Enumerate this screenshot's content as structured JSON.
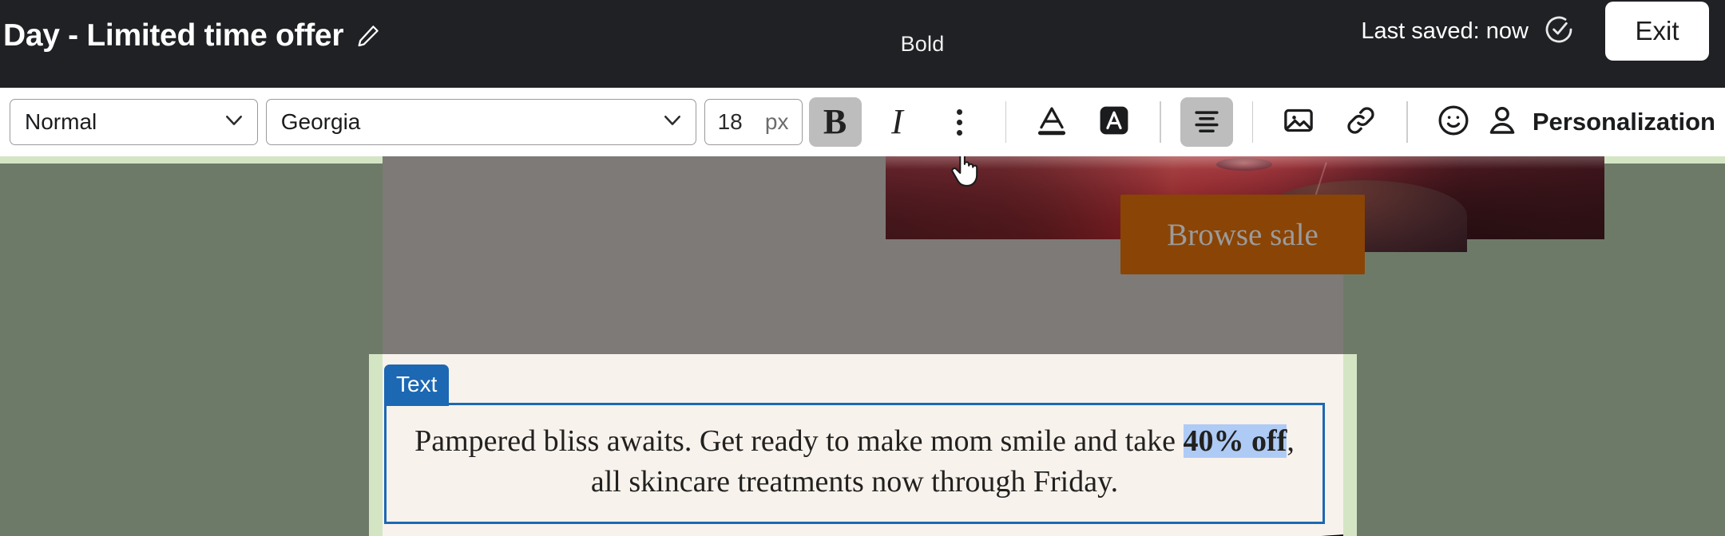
{
  "header": {
    "campaign_title": "Day - Limited time offer",
    "edit_icon": "pencil-icon",
    "tooltip": "Bold",
    "last_saved": "Last saved: now",
    "saved_icon": "check-circle-icon",
    "exit_label": "Exit"
  },
  "toolbar": {
    "paragraph_style": "Normal",
    "font_family": "Georgia",
    "font_size_value": "18",
    "font_size_unit": "px",
    "bold_label": "B",
    "italic_label": "I",
    "more_options_icon": "vertical-dots-icon",
    "text_color_icon": "text-color-icon",
    "highlight_color_icon": "highlight-color-icon",
    "align_icon": "align-center-icon",
    "image_icon": "image-icon",
    "link_icon": "link-icon",
    "emoji_icon": "emoji-icon",
    "personalization_icon": "person-icon",
    "personalization_label": "Personalization"
  },
  "canvas": {
    "browse_button_label": "Browse sale",
    "block_badge": "Text",
    "body_line_1": "Pampered bliss awaits. Get ready to make mom smile and take",
    "body_selected": "40% off",
    "body_line_2_rest": ", all skincare treatments now through Friday."
  },
  "colors": {
    "topbar_bg": "#1f2124",
    "toolbar_bg": "#ffffff",
    "accent_blue": "#1c68b3",
    "selection_highlight": "#aecbf5",
    "stage_dim": "#6e7a68",
    "email_dim": "#7d7a77",
    "page_green": "#d4e5c4",
    "email_bg": "#f7f2ec",
    "cta_brown": "#8a4405"
  }
}
